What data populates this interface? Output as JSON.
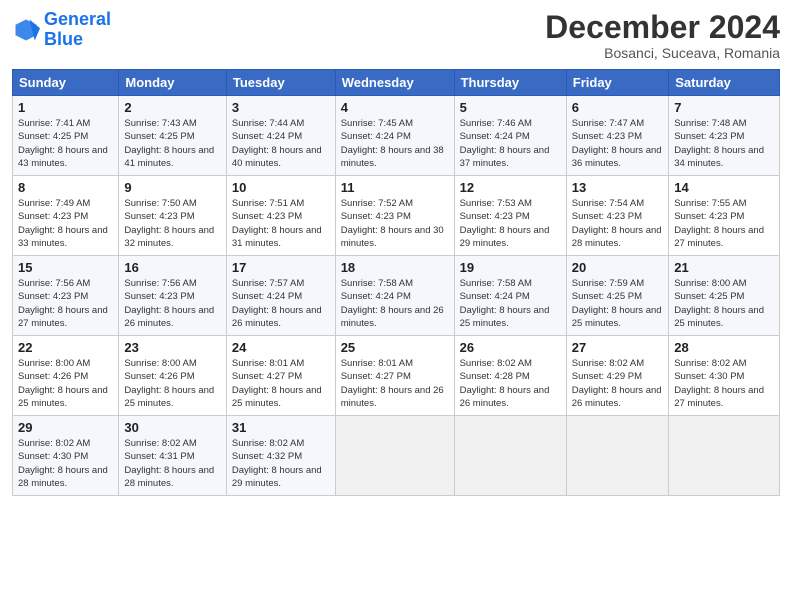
{
  "header": {
    "logo_line1": "General",
    "logo_line2": "Blue",
    "month": "December 2024",
    "location": "Bosanci, Suceava, Romania"
  },
  "weekdays": [
    "Sunday",
    "Monday",
    "Tuesday",
    "Wednesday",
    "Thursday",
    "Friday",
    "Saturday"
  ],
  "weeks": [
    [
      {
        "day": "1",
        "sunrise": "Sunrise: 7:41 AM",
        "sunset": "Sunset: 4:25 PM",
        "daylight": "Daylight: 8 hours and 43 minutes."
      },
      {
        "day": "2",
        "sunrise": "Sunrise: 7:43 AM",
        "sunset": "Sunset: 4:25 PM",
        "daylight": "Daylight: 8 hours and 41 minutes."
      },
      {
        "day": "3",
        "sunrise": "Sunrise: 7:44 AM",
        "sunset": "Sunset: 4:24 PM",
        "daylight": "Daylight: 8 hours and 40 minutes."
      },
      {
        "day": "4",
        "sunrise": "Sunrise: 7:45 AM",
        "sunset": "Sunset: 4:24 PM",
        "daylight": "Daylight: 8 hours and 38 minutes."
      },
      {
        "day": "5",
        "sunrise": "Sunrise: 7:46 AM",
        "sunset": "Sunset: 4:24 PM",
        "daylight": "Daylight: 8 hours and 37 minutes."
      },
      {
        "day": "6",
        "sunrise": "Sunrise: 7:47 AM",
        "sunset": "Sunset: 4:23 PM",
        "daylight": "Daylight: 8 hours and 36 minutes."
      },
      {
        "day": "7",
        "sunrise": "Sunrise: 7:48 AM",
        "sunset": "Sunset: 4:23 PM",
        "daylight": "Daylight: 8 hours and 34 minutes."
      }
    ],
    [
      {
        "day": "8",
        "sunrise": "Sunrise: 7:49 AM",
        "sunset": "Sunset: 4:23 PM",
        "daylight": "Daylight: 8 hours and 33 minutes."
      },
      {
        "day": "9",
        "sunrise": "Sunrise: 7:50 AM",
        "sunset": "Sunset: 4:23 PM",
        "daylight": "Daylight: 8 hours and 32 minutes."
      },
      {
        "day": "10",
        "sunrise": "Sunrise: 7:51 AM",
        "sunset": "Sunset: 4:23 PM",
        "daylight": "Daylight: 8 hours and 31 minutes."
      },
      {
        "day": "11",
        "sunrise": "Sunrise: 7:52 AM",
        "sunset": "Sunset: 4:23 PM",
        "daylight": "Daylight: 8 hours and 30 minutes."
      },
      {
        "day": "12",
        "sunrise": "Sunrise: 7:53 AM",
        "sunset": "Sunset: 4:23 PM",
        "daylight": "Daylight: 8 hours and 29 minutes."
      },
      {
        "day": "13",
        "sunrise": "Sunrise: 7:54 AM",
        "sunset": "Sunset: 4:23 PM",
        "daylight": "Daylight: 8 hours and 28 minutes."
      },
      {
        "day": "14",
        "sunrise": "Sunrise: 7:55 AM",
        "sunset": "Sunset: 4:23 PM",
        "daylight": "Daylight: 8 hours and 27 minutes."
      }
    ],
    [
      {
        "day": "15",
        "sunrise": "Sunrise: 7:56 AM",
        "sunset": "Sunset: 4:23 PM",
        "daylight": "Daylight: 8 hours and 27 minutes."
      },
      {
        "day": "16",
        "sunrise": "Sunrise: 7:56 AM",
        "sunset": "Sunset: 4:23 PM",
        "daylight": "Daylight: 8 hours and 26 minutes."
      },
      {
        "day": "17",
        "sunrise": "Sunrise: 7:57 AM",
        "sunset": "Sunset: 4:24 PM",
        "daylight": "Daylight: 8 hours and 26 minutes."
      },
      {
        "day": "18",
        "sunrise": "Sunrise: 7:58 AM",
        "sunset": "Sunset: 4:24 PM",
        "daylight": "Daylight: 8 hours and 26 minutes."
      },
      {
        "day": "19",
        "sunrise": "Sunrise: 7:58 AM",
        "sunset": "Sunset: 4:24 PM",
        "daylight": "Daylight: 8 hours and 25 minutes."
      },
      {
        "day": "20",
        "sunrise": "Sunrise: 7:59 AM",
        "sunset": "Sunset: 4:25 PM",
        "daylight": "Daylight: 8 hours and 25 minutes."
      },
      {
        "day": "21",
        "sunrise": "Sunrise: 8:00 AM",
        "sunset": "Sunset: 4:25 PM",
        "daylight": "Daylight: 8 hours and 25 minutes."
      }
    ],
    [
      {
        "day": "22",
        "sunrise": "Sunrise: 8:00 AM",
        "sunset": "Sunset: 4:26 PM",
        "daylight": "Daylight: 8 hours and 25 minutes."
      },
      {
        "day": "23",
        "sunrise": "Sunrise: 8:00 AM",
        "sunset": "Sunset: 4:26 PM",
        "daylight": "Daylight: 8 hours and 25 minutes."
      },
      {
        "day": "24",
        "sunrise": "Sunrise: 8:01 AM",
        "sunset": "Sunset: 4:27 PM",
        "daylight": "Daylight: 8 hours and 25 minutes."
      },
      {
        "day": "25",
        "sunrise": "Sunrise: 8:01 AM",
        "sunset": "Sunset: 4:27 PM",
        "daylight": "Daylight: 8 hours and 26 minutes."
      },
      {
        "day": "26",
        "sunrise": "Sunrise: 8:02 AM",
        "sunset": "Sunset: 4:28 PM",
        "daylight": "Daylight: 8 hours and 26 minutes."
      },
      {
        "day": "27",
        "sunrise": "Sunrise: 8:02 AM",
        "sunset": "Sunset: 4:29 PM",
        "daylight": "Daylight: 8 hours and 26 minutes."
      },
      {
        "day": "28",
        "sunrise": "Sunrise: 8:02 AM",
        "sunset": "Sunset: 4:30 PM",
        "daylight": "Daylight: 8 hours and 27 minutes."
      }
    ],
    [
      {
        "day": "29",
        "sunrise": "Sunrise: 8:02 AM",
        "sunset": "Sunset: 4:30 PM",
        "daylight": "Daylight: 8 hours and 28 minutes."
      },
      {
        "day": "30",
        "sunrise": "Sunrise: 8:02 AM",
        "sunset": "Sunset: 4:31 PM",
        "daylight": "Daylight: 8 hours and 28 minutes."
      },
      {
        "day": "31",
        "sunrise": "Sunrise: 8:02 AM",
        "sunset": "Sunset: 4:32 PM",
        "daylight": "Daylight: 8 hours and 29 minutes."
      },
      null,
      null,
      null,
      null
    ]
  ]
}
